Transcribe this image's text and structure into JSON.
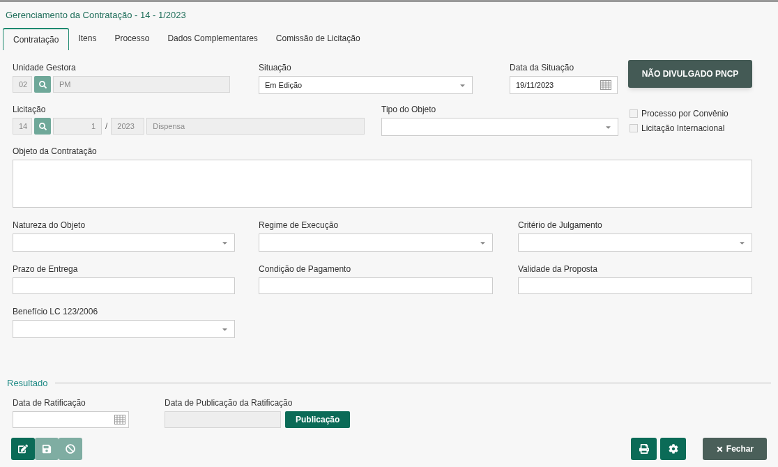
{
  "title": "Gerenciamento da Contratação - 14 - 1/2023",
  "tabs": [
    {
      "label": "Contratação",
      "selected": true
    },
    {
      "label": "Itens",
      "selected": false
    },
    {
      "label": "Processo",
      "selected": false
    },
    {
      "label": "Dados Complementares",
      "selected": false
    },
    {
      "label": "Comissão de Licitação",
      "selected": false
    }
  ],
  "unidade_gestora": {
    "label": "Unidade Gestora",
    "code": "02",
    "name": "PM"
  },
  "situacao": {
    "label": "Situação",
    "value": "Em Edição"
  },
  "data_situacao": {
    "label": "Data da Situação",
    "value": "19/11/2023"
  },
  "status_button": "NÃO DIVULGADO PNCP",
  "licitacao": {
    "label": "Licitação",
    "code": "14",
    "number": "1",
    "separator": "/",
    "year": "2023",
    "modality": "Dispensa"
  },
  "tipo_objeto": {
    "label": "Tipo do Objeto"
  },
  "checkboxes": [
    {
      "label": "Processo por Convênio",
      "checked": false
    },
    {
      "label": "Licitação Internacional",
      "checked": false
    }
  ],
  "objeto": {
    "label": "Objeto da Contratação"
  },
  "fields": [
    {
      "kind": "select",
      "label": "Natureza do Objeto"
    },
    {
      "kind": "select",
      "label": "Regime de Execução"
    },
    {
      "kind": "select",
      "label": "Critério de Julgamento"
    },
    {
      "kind": "text",
      "label": "Prazo de Entrega"
    },
    {
      "kind": "text",
      "label": "Condição de Pagamento"
    },
    {
      "kind": "text",
      "label": "Validade da Proposta"
    },
    {
      "kind": "select",
      "label": "Benefício LC 123/2006"
    }
  ],
  "resultado": {
    "heading": "Resultado",
    "data_ratificacao": "Data de Ratificação",
    "data_publicacao": "Data de Publicação da Ratificação",
    "publicacao_button": "Publicação"
  },
  "toolbar": [
    {
      "kind": "edit",
      "disabled": false
    },
    {
      "kind": "save",
      "disabled": true
    },
    {
      "kind": "cancel",
      "disabled": true
    }
  ],
  "right_buttons": [
    {
      "kind": "print"
    },
    {
      "kind": "settings"
    }
  ],
  "close_button": "Fechar"
}
